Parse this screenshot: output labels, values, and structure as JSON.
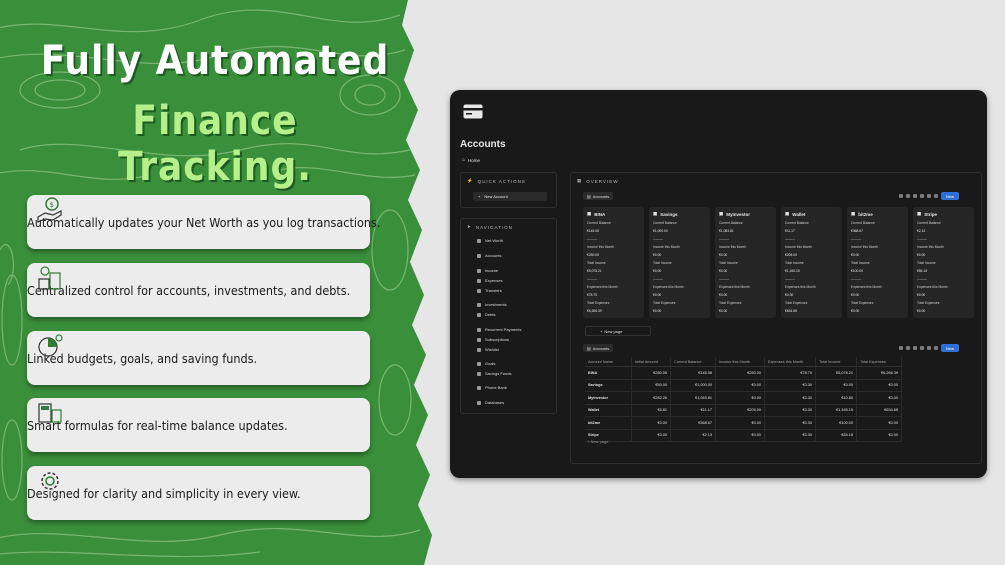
{
  "hero": {
    "line1": "Fully Automated",
    "line2": "Finance Tracking.",
    "colors": {
      "green": "#3a8f3a",
      "accent": "#b6f08a",
      "white": "#ffffff"
    }
  },
  "features": [
    {
      "icon": "hand-money-icon",
      "text": "Automatically updates your Net Worth as you log transactions."
    },
    {
      "icon": "money-stacks-icon",
      "text": "Centralized control for accounts, investments, and debts."
    },
    {
      "icon": "pie-chart-icon",
      "text": "Linked budgets, goals, and saving funds."
    },
    {
      "icon": "calculator-money-icon",
      "text": "Smart formulas for real-time balance updates."
    },
    {
      "icon": "gear-coins-icon",
      "text": "Designed for clarity and simplicity in every view."
    }
  ],
  "app": {
    "title": "Accounts",
    "breadcrumb": "Home",
    "quick_actions": {
      "title": "QUICK ACTIONS",
      "new_account": "New Account"
    },
    "navigation": {
      "title": "NAVIGATION",
      "items": [
        "Net Worth",
        "Accounts",
        "Income",
        "Expenses",
        "Transfers",
        "Investments",
        "Debts",
        "Recurrent Payments",
        "Subscriptions",
        "Wishlist",
        "Goals",
        "Savings Funds",
        "Phone Bank",
        "Databases"
      ]
    },
    "overview": {
      "title": "OVERVIEW",
      "view_tab": "Accounts",
      "new_label": "New",
      "new_page": "New page",
      "cards": [
        {
          "name": "BINA",
          "current_balance": "€145.08",
          "income_month": "€250.00",
          "total_income": "€5,078.21",
          "expenses_month": "€78.70",
          "total_expenses": "€6,266.39"
        },
        {
          "name": "Savings",
          "current_balance": "€1,000.00",
          "income_month": "€0.00",
          "total_income": "€0.00",
          "expenses_month": "€0.00",
          "total_expenses": "€0.00"
        },
        {
          "name": "MyInvestor",
          "current_balance": "€1,083.81",
          "income_month": "€0.00",
          "total_income": "€0.00",
          "expenses_month": "€0.00",
          "total_expenses": "€0.00"
        },
        {
          "name": "Wallet",
          "current_balance": "€11.17",
          "income_month": "€205.00",
          "total_income": "€1,165.15",
          "expenses_month": "€0.30",
          "total_expenses": "€634.68"
        },
        {
          "name": "bit2me",
          "current_balance": "€368.67",
          "income_month": "€0.00",
          "total_income": "€100.00",
          "expenses_month": "€0.00",
          "total_expenses": "€0.00"
        },
        {
          "name": "Stripe",
          "current_balance": "€2.13",
          "income_month": "€0.00",
          "total_income": "€84.18",
          "expenses_month": "€0.00",
          "total_expenses": "€0.00"
        }
      ],
      "card_labels": {
        "current_balance": "Current Balance",
        "income_month": "Income this Month",
        "total_income": "Total Income",
        "expenses_month": "Expenses this Month",
        "total_expenses": "Total Expenses"
      }
    },
    "table": {
      "view_tab": "Accounts",
      "new_label": "New",
      "new_page": "New page",
      "headers": [
        "Account Name",
        "Initial Amount",
        "Current Balance",
        "Income this Month",
        "Expenses this Month",
        "Total Income",
        "Total Expenses"
      ],
      "rows": [
        [
          "BINA",
          "€280.05",
          "€145.08",
          "€250.00",
          "€78.70",
          "€5,078.21",
          "€6,266.39"
        ],
        [
          "Savings",
          "€50.00",
          "€1,000.00",
          "€0.00",
          "€0.30",
          "€0.00",
          "€0.00"
        ],
        [
          "MyInvestor",
          "€282.26",
          "€1,083.81",
          "€0.00",
          "€0.30",
          "€10.80",
          "€0.00"
        ],
        [
          "Wallet",
          "€5.81",
          "€11.17",
          "€205.00",
          "€0.30",
          "€1,165.15",
          "€634.68"
        ],
        [
          "bit2me",
          "€0.00",
          "€368.67",
          "€0.00",
          "€0.30",
          "€100.00",
          "€0.00"
        ],
        [
          "Stripe",
          "€0.00",
          "€2.13",
          "€0.00",
          "€0.30",
          "€84.18",
          "€0.00"
        ]
      ]
    }
  }
}
